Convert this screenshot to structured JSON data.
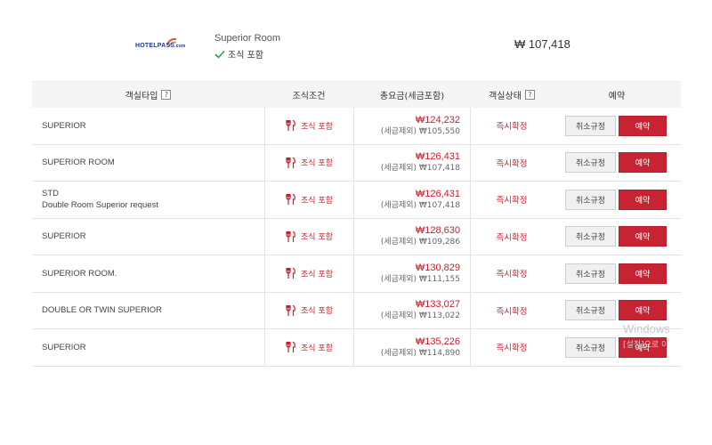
{
  "summary": {
    "logo_text": "HOTELPASS",
    "logo_suffix": ".com",
    "room_name": "Superior Room",
    "breakfast_label": "조식 포함",
    "price": "₩ 107,418"
  },
  "table": {
    "headers": {
      "room_type": "객실타입",
      "condition": "조식조건",
      "total": "총요금(세금포함)",
      "status": "객실상태",
      "reserve": "예약"
    },
    "help_mark": "?",
    "rows": [
      {
        "type_line1": "SUPERIOR",
        "type_line2": "",
        "condition": "조식 포함",
        "price": "₩124,232",
        "price_ex": "(세금제외) ₩105,550",
        "status": "즉시확정",
        "cancel": "취소규정",
        "book": "예약"
      },
      {
        "type_line1": "SUPERIOR ROOM",
        "type_line2": "",
        "condition": "조식 포함",
        "price": "₩126,431",
        "price_ex": "(세금제외) ₩107,418",
        "status": "즉시확정",
        "cancel": "취소규정",
        "book": "예약"
      },
      {
        "type_line1": "STD",
        "type_line2": "Double Room Superior request",
        "condition": "조식 포함",
        "price": "₩126,431",
        "price_ex": "(세금제외) ₩107,418",
        "status": "즉시확정",
        "cancel": "취소규정",
        "book": "예약"
      },
      {
        "type_line1": "SUPERIOR",
        "type_line2": "",
        "condition": "조식 포함",
        "price": "₩128,630",
        "price_ex": "(세금제외) ₩109,286",
        "status": "즉시확정",
        "cancel": "취소규정",
        "book": "예약"
      },
      {
        "type_line1": "SUPERIOR ROOM.",
        "type_line2": "",
        "condition": "조식 포함",
        "price": "₩130,829",
        "price_ex": "(세금제외) ₩111,155",
        "status": "즉시확정",
        "cancel": "취소규정",
        "book": "예약"
      },
      {
        "type_line1": "DOUBLE OR TWIN SUPERIOR",
        "type_line2": "",
        "condition": "조식 포함",
        "price": "₩133,027",
        "price_ex": "(세금제외) ₩113,022",
        "status": "즉시확정",
        "cancel": "취소규정",
        "book": "예약"
      },
      {
        "type_line1": "SUPERIOR",
        "type_line2": "",
        "condition": "조식 포함",
        "price": "₩135,226",
        "price_ex": "(세금제외) ₩114,890",
        "status": "즉시확정",
        "cancel": "취소규정",
        "book": "예약"
      }
    ]
  },
  "watermark": {
    "title": "Windows",
    "subtitle": "[설정]으로 이"
  },
  "colors": {
    "accent": "#c8202f",
    "book_button": "#c82333",
    "header_bg": "#f5f5f5"
  },
  "icons": {
    "breakfast": "fork-knife-icon",
    "included": "checkmark-icon",
    "help": "help-icon"
  }
}
